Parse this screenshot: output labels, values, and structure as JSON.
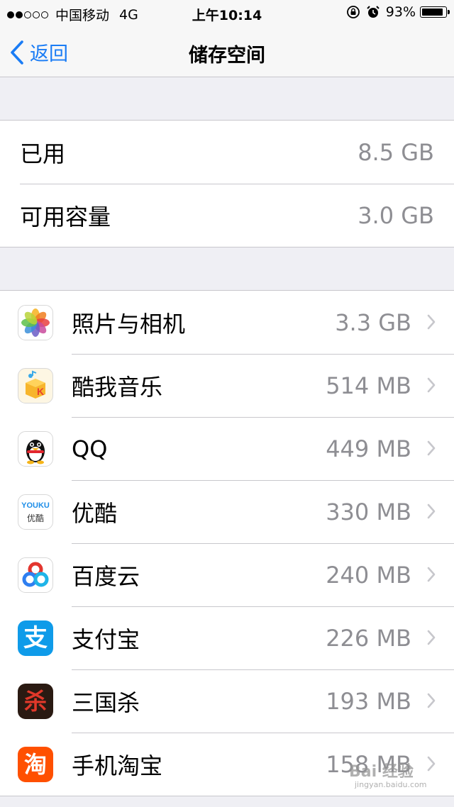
{
  "status_bar": {
    "carrier": "中国移动",
    "network": "4G",
    "time": "上午10:14",
    "battery_percent": "93%",
    "battery_level": 0.93,
    "signal_bars_filled": 2,
    "signal_bars_total": 5
  },
  "nav": {
    "back_label": "返回",
    "title": "储存空间"
  },
  "summary": [
    {
      "label": "已用",
      "value": "8.5 GB"
    },
    {
      "label": "可用容量",
      "value": "3.0 GB"
    }
  ],
  "apps": [
    {
      "name": "照片与相机",
      "size": "3.3 GB",
      "icon": "photos-icon"
    },
    {
      "name": "酷我音乐",
      "size": "514 MB",
      "icon": "kuwo-music-icon"
    },
    {
      "name": "QQ",
      "size": "449 MB",
      "icon": "qq-penguin-icon"
    },
    {
      "name": "优酷",
      "size": "330 MB",
      "icon": "youku-icon",
      "icon_text_top": "YOUKU",
      "icon_text_bottom": "优酷"
    },
    {
      "name": "百度云",
      "size": "240 MB",
      "icon": "baidu-cloud-icon"
    },
    {
      "name": "支付宝",
      "size": "226 MB",
      "icon": "alipay-icon",
      "icon_text": "支"
    },
    {
      "name": "三国杀",
      "size": "193 MB",
      "icon": "sanguosha-icon",
      "icon_text": "杀"
    },
    {
      "name": "手机淘宝",
      "size": "158 MB",
      "icon": "taobao-icon",
      "icon_text": "淘"
    }
  ],
  "watermark": {
    "text": "Bai 经验",
    "sub": "jingyan.baidu.com"
  },
  "colors": {
    "accent": "#1a7cf5",
    "secondary_text": "#8e8e93",
    "separator": "#c8c7cc",
    "background": "#efeff4"
  }
}
